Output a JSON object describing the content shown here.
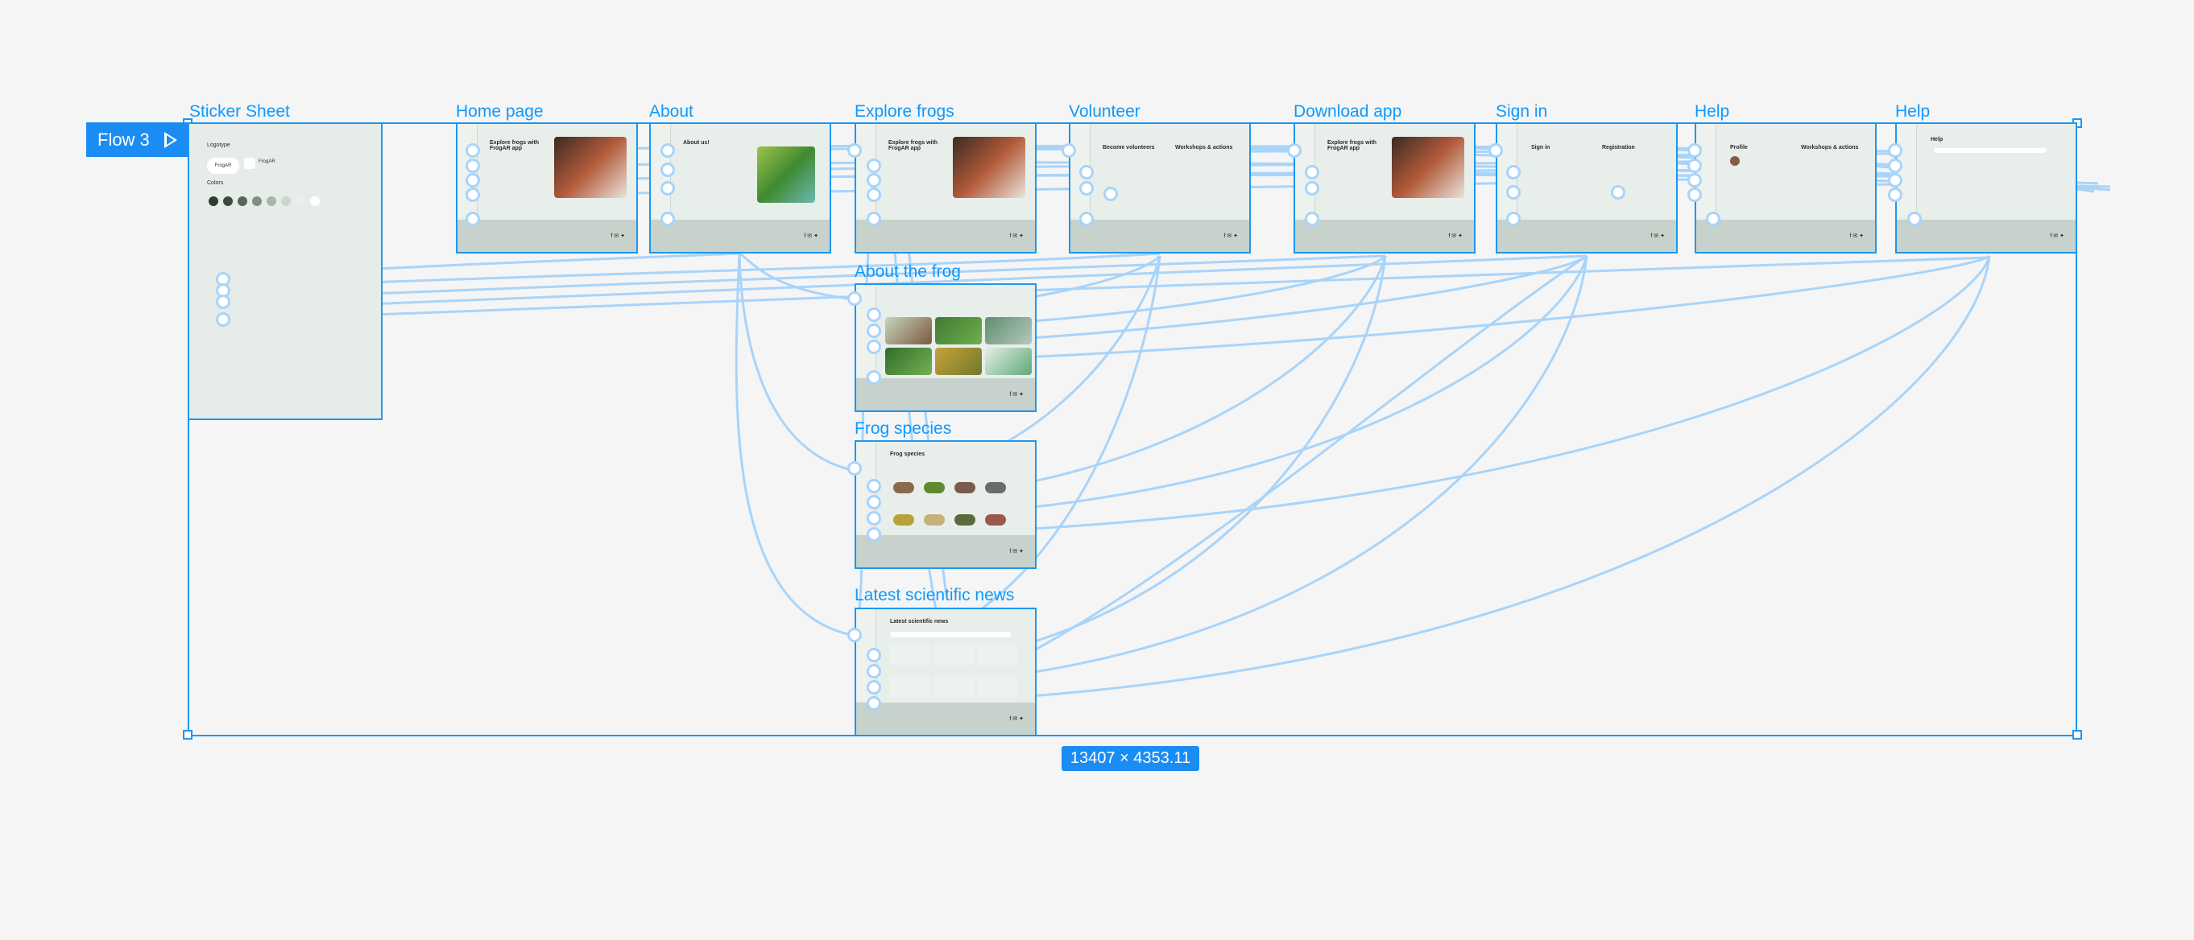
{
  "flow": {
    "label": "Flow 3"
  },
  "selection": {
    "size_label": "13407 × 4353.11"
  },
  "frames": [
    {
      "key": "sticker",
      "label": "Sticker Sheet"
    },
    {
      "key": "home",
      "label": "Home page",
      "heading": "Explore frogs with FrogAR app"
    },
    {
      "key": "about",
      "label": "About",
      "heading": "About us!"
    },
    {
      "key": "explore",
      "label": "Explore frogs",
      "heading": "Explore frogs with FrogAR app"
    },
    {
      "key": "volunteer",
      "label": "Volunteer",
      "heading": "Become volunteers",
      "heading2": "Workshops & actions"
    },
    {
      "key": "download",
      "label": "Download app",
      "heading": "Explore frogs with FrogAR app"
    },
    {
      "key": "signin",
      "label": "Sign in",
      "heading": "Sign in",
      "heading2": "Registration"
    },
    {
      "key": "help1",
      "label": "Help",
      "heading": "Profile",
      "heading2": "Workshops & actions"
    },
    {
      "key": "help2",
      "label": "Help",
      "heading": "Help"
    },
    {
      "key": "aboutfrog",
      "label": "About the frog"
    },
    {
      "key": "species",
      "label": "Frog species",
      "heading": "Frog species"
    },
    {
      "key": "news",
      "label": "Latest scientific news",
      "heading": "Latest scientific news"
    }
  ],
  "sticker": {
    "logotype": "Logotype",
    "colors": "Colors",
    "brand": "FrogAR"
  },
  "colors": {
    "accent": "#1e96f0",
    "connector": "#a8d4fa",
    "frame_bg": "#e8eeea",
    "footer_bg": "#c6d2cb"
  }
}
